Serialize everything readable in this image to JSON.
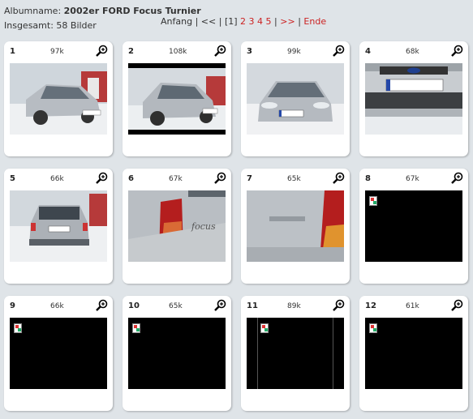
{
  "album": {
    "label": "Albumname:",
    "name": "2002er FORD Focus Turnier",
    "total_label": "Insgesamt: 58 Bilder"
  },
  "pager": {
    "start": "Anfang",
    "sep": "|",
    "prev": "<<",
    "current": "[1]",
    "p2": "2",
    "p3": "3",
    "p4": "4",
    "p5": "5",
    "next": ">>",
    "end": "Ende"
  },
  "thumbs": [
    {
      "num": "1",
      "size": "97k"
    },
    {
      "num": "2",
      "size": "108k"
    },
    {
      "num": "3",
      "size": "99k"
    },
    {
      "num": "4",
      "size": "68k"
    },
    {
      "num": "5",
      "size": "66k"
    },
    {
      "num": "6",
      "size": "67k"
    },
    {
      "num": "7",
      "size": "65k"
    },
    {
      "num": "8",
      "size": "67k"
    },
    {
      "num": "9",
      "size": "66k"
    },
    {
      "num": "10",
      "size": "65k"
    },
    {
      "num": "11",
      "size": "89k"
    },
    {
      "num": "12",
      "size": "61k"
    }
  ],
  "colors": {
    "link": "#cc2222",
    "background": "#dfe4e8"
  }
}
